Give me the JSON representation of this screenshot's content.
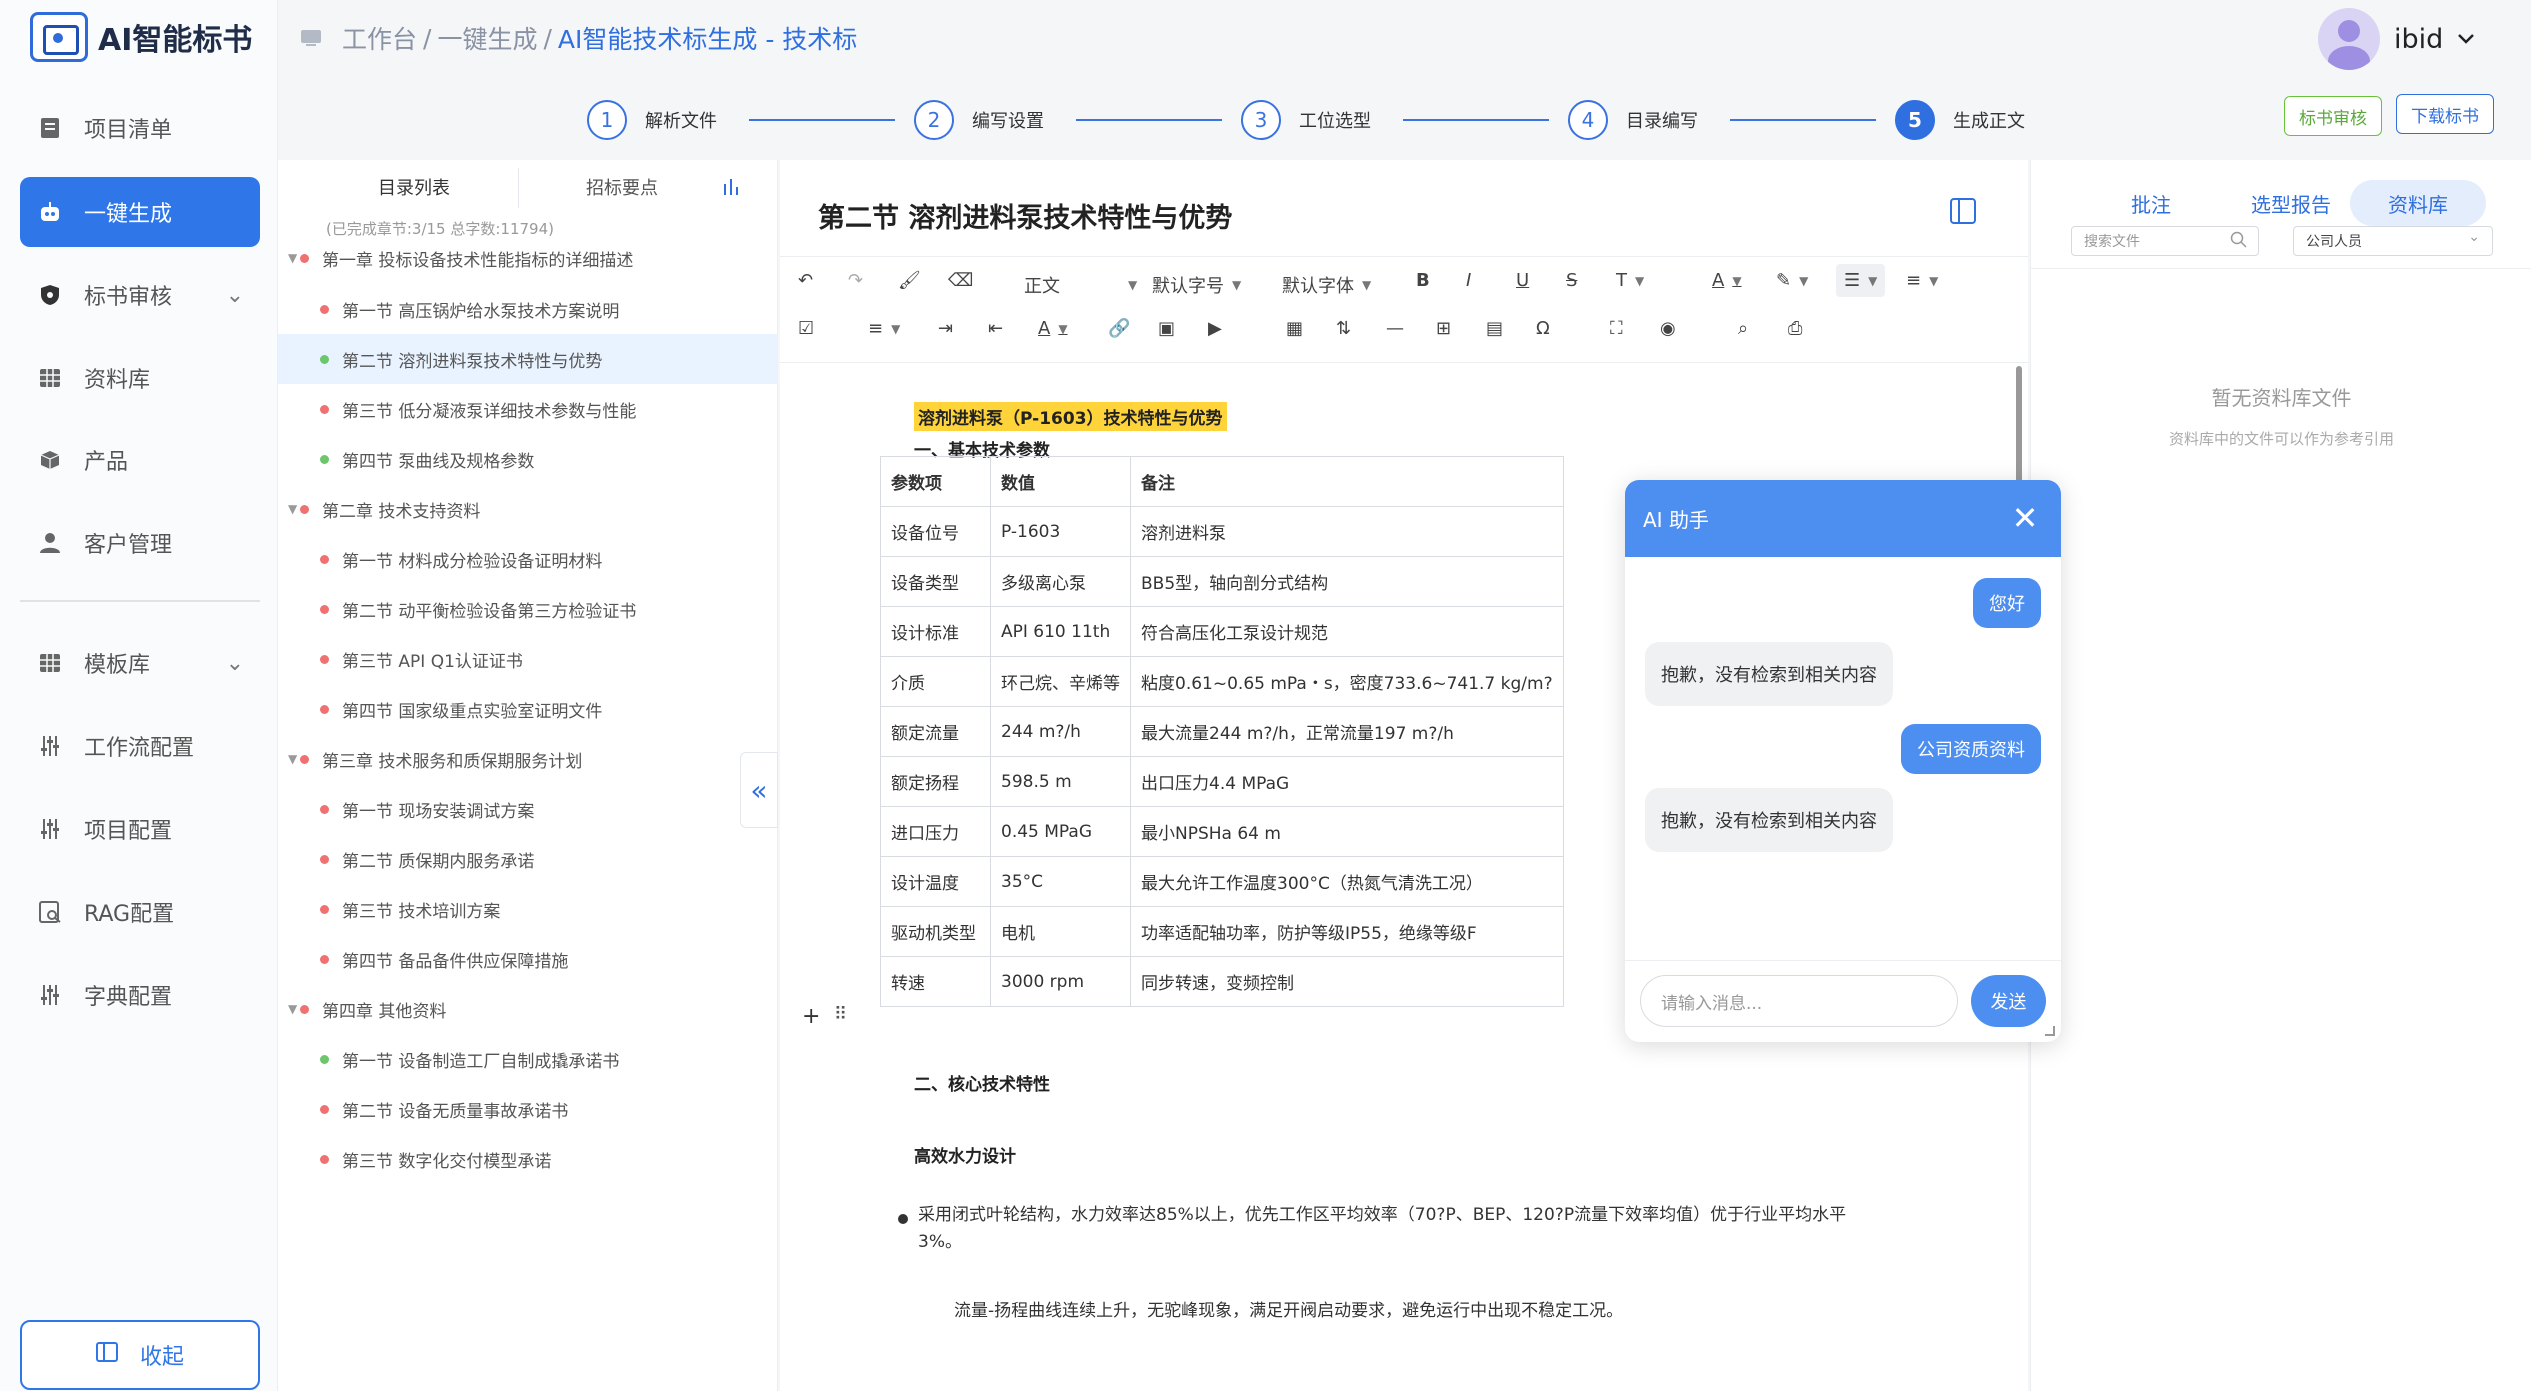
{
  "app": {
    "title": "AI智能标书"
  },
  "sidebar": {
    "items": [
      {
        "label": "项目清单",
        "icon": "document-icon"
      },
      {
        "label": "一键生成",
        "icon": "robot-icon"
      },
      {
        "label": "标书审核",
        "icon": "shield-icon"
      },
      {
        "label": "资料库",
        "icon": "grid-icon"
      },
      {
        "label": "产品",
        "icon": "box-icon"
      },
      {
        "label": "客户管理",
        "icon": "user-icon"
      },
      {
        "label": "模板库",
        "icon": "grid-icon"
      },
      {
        "label": "工作流配置",
        "icon": "sliders-icon"
      },
      {
        "label": "项目配置",
        "icon": "sliders-icon"
      },
      {
        "label": "RAG配置",
        "icon": "rag-icon"
      },
      {
        "label": "字典配置",
        "icon": "sliders-icon"
      }
    ],
    "collapse_label": "收起"
  },
  "breadcrumb": {
    "items": [
      "工作台",
      "一键生成",
      "AI智能技术标生成 - 技术标"
    ]
  },
  "user": {
    "name": "ibid"
  },
  "steps": [
    {
      "num": "1",
      "label": "解析文件"
    },
    {
      "num": "2",
      "label": "编写设置"
    },
    {
      "num": "3",
      "label": "工位选型"
    },
    {
      "num": "4",
      "label": "目录编写"
    },
    {
      "num": "5",
      "label": "生成正文"
    }
  ],
  "header_buttons": {
    "review": "标书审核",
    "download": "下载标书"
  },
  "toc": {
    "tabs": [
      "目录列表",
      "招标要点"
    ],
    "summary": "(已完成章节:3/15   总字数:11794)",
    "rows": [
      {
        "label": "第一章 投标设备技术性能指标的详细描述",
        "level": 1,
        "status": "red"
      },
      {
        "label": "第一节 高压锅炉给水泵技术方案说明",
        "level": 2,
        "status": "red"
      },
      {
        "label": "第二节 溶剂进料泵技术特性与优势",
        "level": 2,
        "status": "green"
      },
      {
        "label": "第三节 低分凝液泵详细技术参数与性能",
        "level": 2,
        "status": "red"
      },
      {
        "label": "第四节 泵曲线及规格参数",
        "level": 2,
        "status": "green"
      },
      {
        "label": "第二章 技术支持资料",
        "level": 1,
        "status": "red"
      },
      {
        "label": "第一节 材料成分检验设备证明材料",
        "level": 2,
        "status": "red"
      },
      {
        "label": "第二节 动平衡检验设备第三方检验证书",
        "level": 2,
        "status": "red"
      },
      {
        "label": "第三节 API Q1认证证书",
        "level": 2,
        "status": "red"
      },
      {
        "label": "第四节 国家级重点实验室证明文件",
        "level": 2,
        "status": "red"
      },
      {
        "label": "第三章 技术服务和质保期服务计划",
        "level": 1,
        "status": "red"
      },
      {
        "label": "第一节 现场安装调试方案",
        "level": 2,
        "status": "red"
      },
      {
        "label": "第二节 质保期内服务承诺",
        "level": 2,
        "status": "red"
      },
      {
        "label": "第三节 技术培训方案",
        "level": 2,
        "status": "red"
      },
      {
        "label": "第四节 备品备件供应保障措施",
        "level": 2,
        "status": "red"
      },
      {
        "label": "第四章 其他资料",
        "level": 1,
        "status": "red"
      },
      {
        "label": "第一节 设备制造工厂自制成撬承诺书",
        "level": 2,
        "status": "green"
      },
      {
        "label": "第二节 设备无质量事故承诺书",
        "level": 2,
        "status": "red"
      },
      {
        "label": "第三节 数字化交付模型承诺",
        "level": 2,
        "status": "red"
      }
    ]
  },
  "editor": {
    "title": "第二节 溶剂进料泵技术特性与优势",
    "toolbar": {
      "paragraph": "正文",
      "font_size": "默认字号",
      "font_family": "默认字体"
    },
    "content": {
      "highlight_title": "溶剂进料泵（P-1603）技术特性与优势",
      "section1": "一、基本技术参数",
      "table": [
        [
          "参数项",
          "数值",
          "备注"
        ],
        [
          "设备位号",
          "P-1603",
          "溶剂进料泵"
        ],
        [
          "设备类型",
          "多级离心泵",
          "BB5型，轴向剖分式结构"
        ],
        [
          "设计标准",
          "API 610 11th",
          "符合高压化工泵设计规范"
        ],
        [
          "介质",
          "环己烷、辛烯等",
          "粘度0.61~0.65 mPa・s，密度733.6~741.7 kg/m?"
        ],
        [
          "额定流量",
          "244 m?/h",
          "最大流量244 m?/h，正常流量197 m?/h"
        ],
        [
          "额定扬程",
          "598.5 m",
          "出口压力4.4 MPaG"
        ],
        [
          "进口压力",
          "0.45 MPaG",
          "最小NPSHa 64 m"
        ],
        [
          "设计温度",
          "35°C",
          "最大允许工作温度300°C（热氮气清洗工况）"
        ],
        [
          "驱动机类型",
          "电机",
          "功率适配轴功率，防护等级IP55，绝缘等级F"
        ],
        [
          "转速",
          "3000 rpm",
          "同步转速，变频控制"
        ]
      ],
      "section2": "二、核心技术特性",
      "sub1": "高效水力设计",
      "bullet1": "采用闭式叶轮结构，水力效率达85%以上，优先工作区平均效率（70?P、BEP、120?P流量下效率均值）优于行业平均水平3%。",
      "para1": "流量-扬程曲线连续上升，无驼峰现象，满足开阀启动要求，避免运行中出现不稳定工况。"
    }
  },
  "rpanel": {
    "tabs": [
      "批注",
      "选型报告",
      "资料库"
    ],
    "search_placeholder": "搜索文件",
    "select_value": "公司人员",
    "empty_title": "暂无资料库文件",
    "empty_sub": "资料库中的文件可以作为参考引用"
  },
  "chat": {
    "title": "AI 助手",
    "messages": [
      {
        "role": "user",
        "text": "您好"
      },
      {
        "role": "assistant",
        "text": "抱歉，没有检索到相关内容"
      },
      {
        "role": "user",
        "text": "公司资质资料"
      },
      {
        "role": "assistant",
        "text": "抱歉，没有检索到相关内容"
      }
    ],
    "input_placeholder": "请输入消息...",
    "send_label": "发送"
  }
}
